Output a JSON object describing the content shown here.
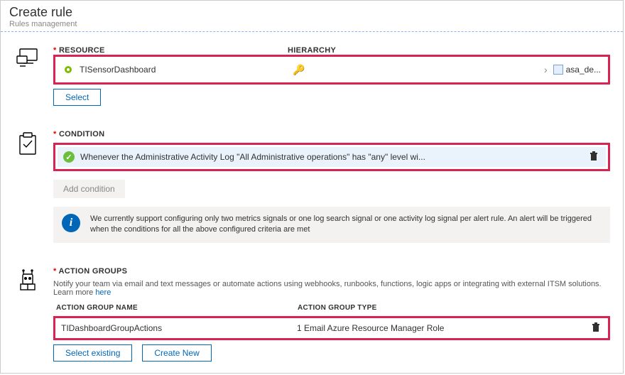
{
  "header": {
    "title": "Create rule",
    "subtitle": "Rules management"
  },
  "resource": {
    "label": "RESOURCE",
    "hierarchy_label": "HIERARCHY",
    "name": "TISensorDashboard",
    "target_name": "asa_de...",
    "select_btn": "Select"
  },
  "condition": {
    "label": "CONDITION",
    "text": "Whenever the Administrative Activity Log \"All Administrative operations\" has \"any\" level wi...",
    "add_btn": "Add condition",
    "info_text": "We currently support configuring only two metrics signals or one log search signal or one activity log signal per alert rule. An alert will be triggered when the conditions for all the above configured criteria are met"
  },
  "action_groups": {
    "label": "ACTION GROUPS",
    "desc_prefix": "Notify your team via email and text messages or automate actions using webhooks, runbooks, functions, logic apps or integrating with external ITSM solutions. Learn more ",
    "learn_more": "here",
    "col_name": "ACTION GROUP NAME",
    "col_type": "ACTION GROUP TYPE",
    "row_name": "TIDashboardGroupActions",
    "row_type": "1 Email Azure Resource Manager Role",
    "select_existing_btn": "Select existing",
    "create_new_btn": "Create New"
  }
}
